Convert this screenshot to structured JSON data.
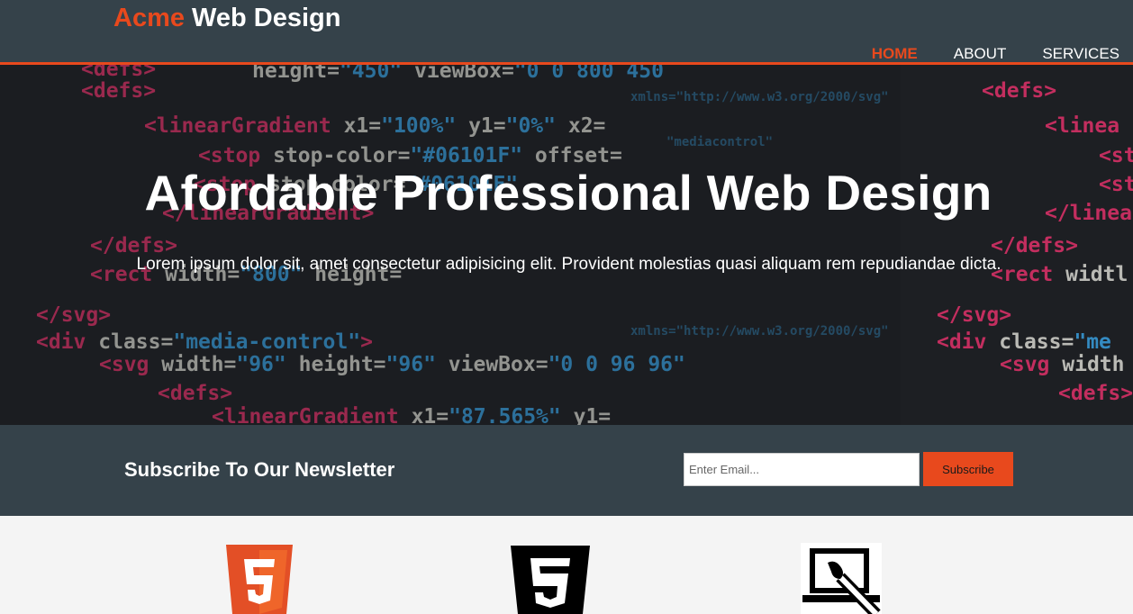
{
  "header": {
    "brand_highlight": "Acme",
    "brand_rest": " Web Design",
    "nav": [
      {
        "label": "Home",
        "current": true
      },
      {
        "label": "About",
        "current": false
      },
      {
        "label": "Services",
        "current": false
      }
    ]
  },
  "showcase": {
    "title": "Afordable Professional Web Design",
    "text": "Lorem ipsum dolor sit, amet consectetur adipisicing elit. Provident molestias quasi aliquam rem repudiandae dicta."
  },
  "newsletter": {
    "title": "Subscribe To Our Newsletter",
    "email_placeholder": "Enter Email...",
    "button_label": "Subscribe"
  },
  "boxes": {
    "icons": [
      "html5-logo-icon",
      "css3-logo-icon",
      "web-design-brush-icon"
    ]
  },
  "colors": {
    "accent": "#e8491d",
    "header_bg": "#35424a",
    "page_bg": "#f4f4f4"
  }
}
